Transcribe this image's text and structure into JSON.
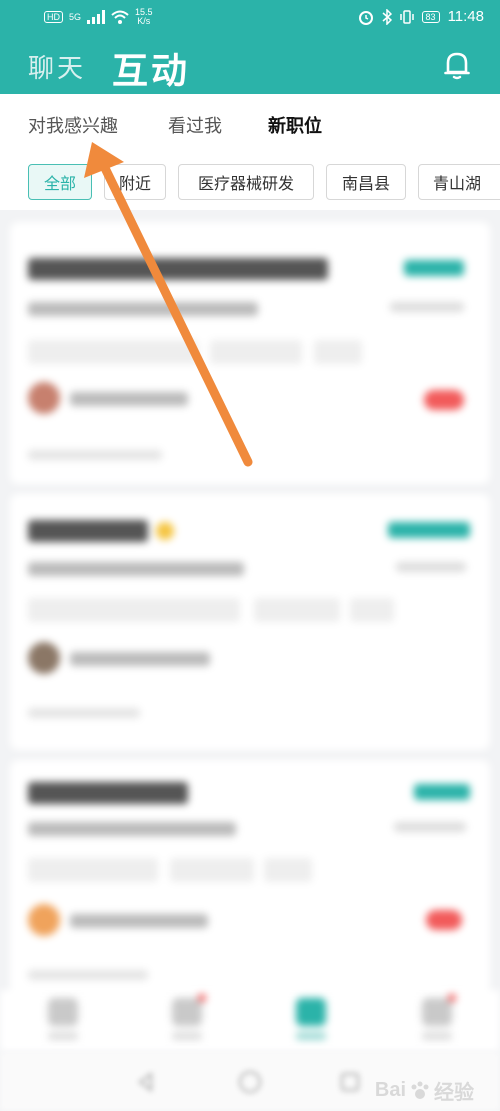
{
  "status_bar": {
    "hd": "HD",
    "network": "5G",
    "speed_value": "15.5",
    "speed_unit": "K/s",
    "battery": "83",
    "time": "11:48"
  },
  "header": {
    "chat_tab": "聊天",
    "interact_tab": "互动"
  },
  "sub_tabs": [
    {
      "label": "对我感兴趣"
    },
    {
      "label": "看过我"
    },
    {
      "label": "新职位"
    }
  ],
  "filters": [
    {
      "label": "全部"
    },
    {
      "label": "附近"
    },
    {
      "label": "医疗器械研发"
    },
    {
      "label": "南昌县"
    },
    {
      "label": "青山湖"
    }
  ],
  "colors": {
    "primary": "#2bb3a9",
    "arrow": "#f08a3c",
    "salary_red": "#f25b5b"
  },
  "watermark": {
    "text": "Bai",
    "suffix": "经验"
  }
}
